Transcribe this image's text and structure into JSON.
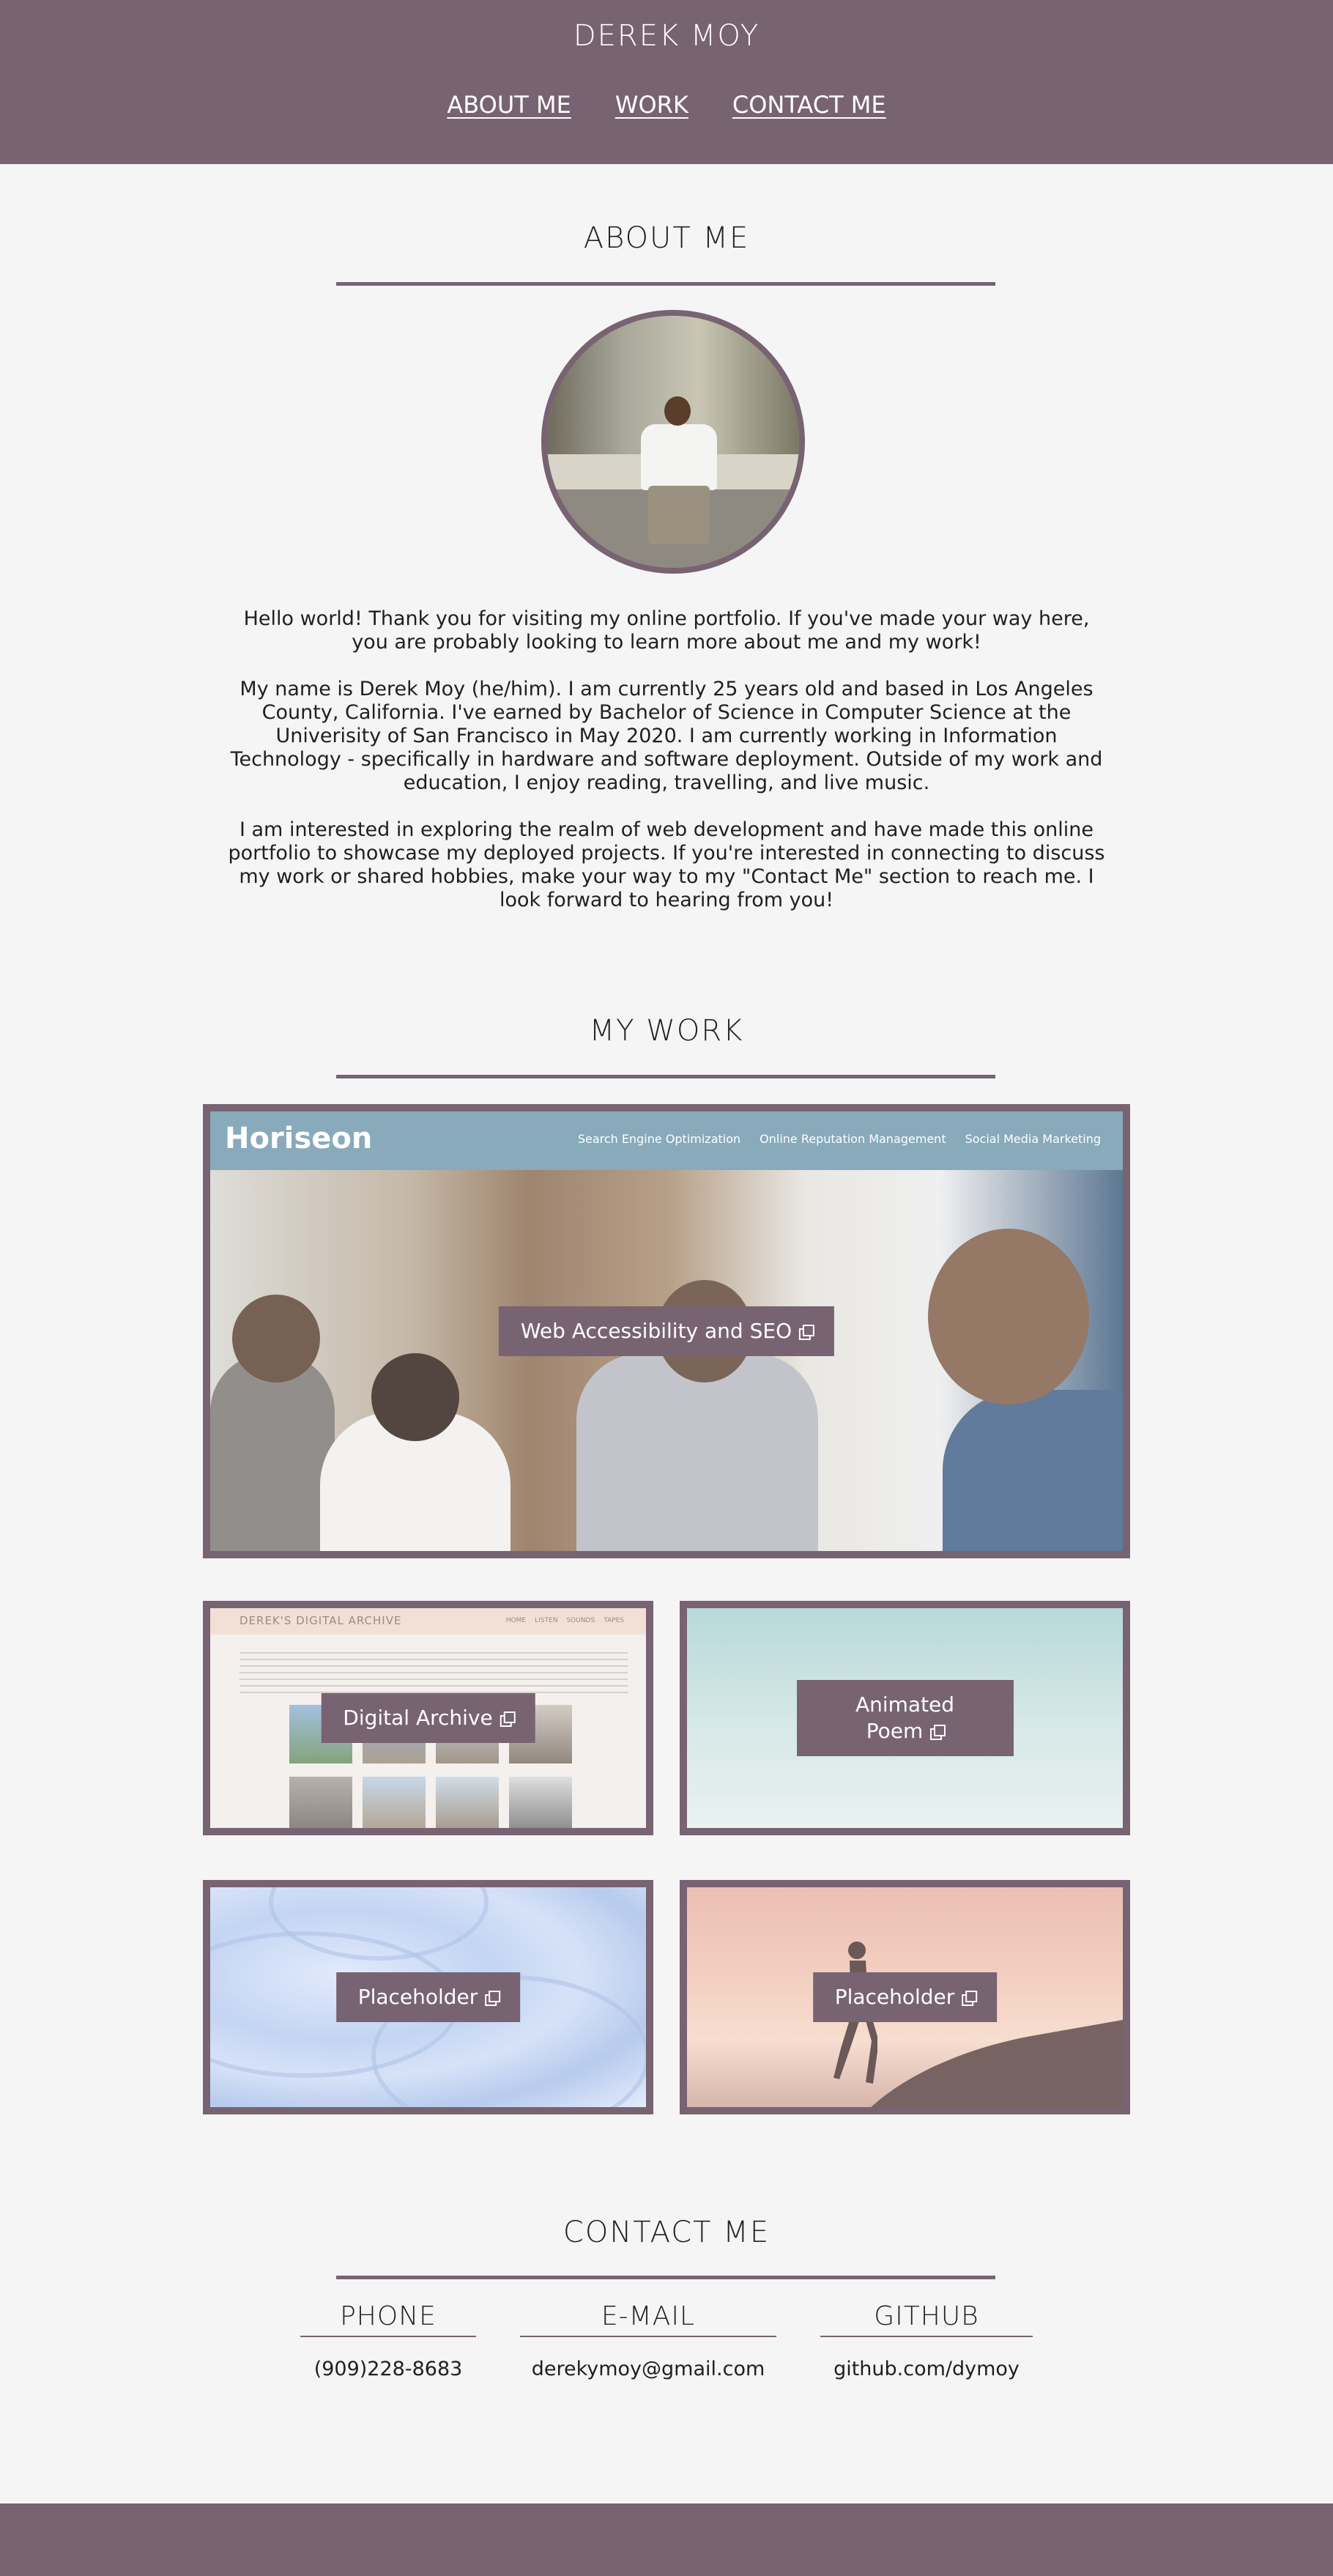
{
  "header": {
    "name": "DEREK MOY",
    "nav": [
      "ABOUT ME",
      "WORK",
      "CONTACT ME"
    ]
  },
  "about": {
    "title": "ABOUT ME",
    "paragraphs": [
      "Hello world! Thank you for visiting my online portfolio. If you've made your way here, you are probably looking to learn more about me and my work!",
      "My name is Derek Moy (he/him). I am currently 25 years old and based in Los Angeles County, California. I've earned by Bachelor of Science in Computer Science at the Univerisity of San Francisco in May 2020. I am currently working in Information Technology - specifically in hardware and software deployment. Outside of my work and education, I enjoy reading, travelling, and live music.",
      "I am interested in exploring the realm of web development and have made this online portfolio to showcase my deployed projects. If you're interested in connecting to discuss my work or shared hobbies, make your way to my \"Contact Me\" section to reach me. I look forward to hearing from you!"
    ]
  },
  "work": {
    "title": "MY WORK",
    "projects": [
      {
        "label": "Web Accessibility and SEO",
        "preview": {
          "brand": "Horiseon",
          "links": [
            "Search Engine Optimization",
            "Online Reputation Management",
            "Social Media Marketing"
          ]
        }
      },
      {
        "label": "Digital Archive",
        "preview": {
          "brand": "DEREK'S DIGITAL ARCHIVE",
          "links": [
            "HOME",
            "LISTEN",
            "SOUNDS",
            "TAPES"
          ]
        }
      },
      {
        "label_line1": "Animated",
        "label_line2": "Poem"
      },
      {
        "label": "Placeholder"
      },
      {
        "label": "Placeholder"
      }
    ]
  },
  "contact": {
    "title": "CONTACT ME",
    "columns": [
      {
        "head": "PHONE",
        "value": "(909)228-8683"
      },
      {
        "head": "E-MAIL",
        "value": "derekymoy@gmail.com"
      },
      {
        "head": "GITHUB",
        "value": "github.com/dymoy"
      }
    ]
  },
  "colors": {
    "accent": "#786372",
    "background": "#f5f5f5"
  },
  "icons": [
    "external-link-icon"
  ]
}
